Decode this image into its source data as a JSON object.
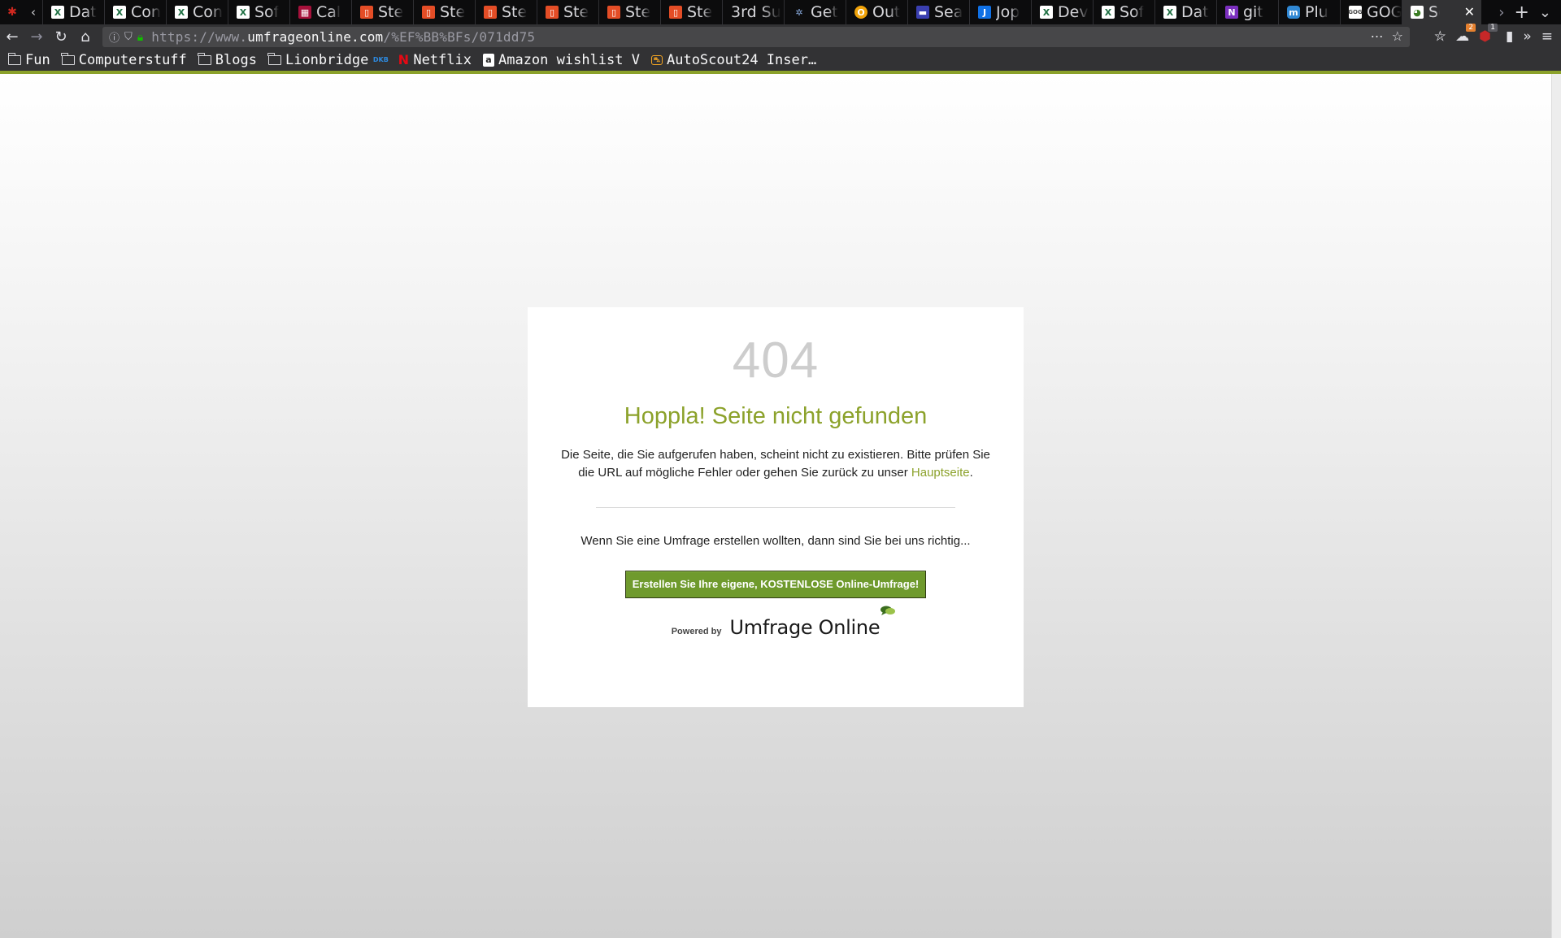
{
  "browser": {
    "tabs": [
      {
        "label": "Dat",
        "favicon": "x-icon"
      },
      {
        "label": "Con",
        "favicon": "x-icon"
      },
      {
        "label": "Con",
        "favicon": "x-icon"
      },
      {
        "label": "Sof",
        "favicon": "x-icon"
      },
      {
        "label": "Cal",
        "favicon": "cal-icon"
      },
      {
        "label": "Ste",
        "favicon": "doc-icon"
      },
      {
        "label": "Ste",
        "favicon": "doc-icon"
      },
      {
        "label": "Ste",
        "favicon": "doc-icon"
      },
      {
        "label": "Ste",
        "favicon": "doc-icon"
      },
      {
        "label": "Ste",
        "favicon": "doc-icon"
      },
      {
        "label": "Ste",
        "favicon": "doc-icon"
      },
      {
        "label": "3rd Su",
        "favicon": "none"
      },
      {
        "label": "Get",
        "favicon": "get-icon"
      },
      {
        "label": "Out",
        "favicon": "out-icon"
      },
      {
        "label": "Sea",
        "favicon": "sea-icon"
      },
      {
        "label": "Jop",
        "favicon": "j-icon"
      },
      {
        "label": "Dev",
        "favicon": "x-icon"
      },
      {
        "label": "Sof",
        "favicon": "x-icon"
      },
      {
        "label": "Dat",
        "favicon": "x-icon"
      },
      {
        "label": "git",
        "favicon": "n-icon"
      },
      {
        "label": "Plu",
        "favicon": "m-icon"
      },
      {
        "label": "GOG",
        "favicon": "gog-icon"
      },
      {
        "label": "Sc",
        "favicon": "umf-icon",
        "active": true
      }
    ],
    "url": {
      "prefix": "https://www.",
      "host": "umfrageonline.com",
      "path": "/%EF%BB%BFs/071dd75"
    },
    "badges": {
      "sync": "2",
      "ublock": "1"
    },
    "bookmarks": [
      {
        "label": "Fun",
        "icon": "folder-icon"
      },
      {
        "label": "Computerstuff",
        "icon": "folder-icon"
      },
      {
        "label": "Blogs",
        "icon": "folder-icon"
      },
      {
        "label": "Lionbridge",
        "icon": "folder-icon"
      },
      {
        "label": "",
        "icon": "dkb-icon",
        "text": "DKB"
      },
      {
        "label": "Netflix",
        "icon": "netflix-icon"
      },
      {
        "label": "Amazon wishlist V",
        "icon": "amazon-icon"
      },
      {
        "label": "AutoScout24 Inser…",
        "icon": "autoscout-icon"
      }
    ]
  },
  "page": {
    "error_code": "404",
    "title": "Hoppla! Seite nicht gefunden",
    "message_1": "Die Seite, die Sie aufgerufen haben, scheint nicht zu existieren. Bitte prüfen Sie die URL auf mögliche Fehler oder gehen Sie zurück zu unser ",
    "message_link": "Hauptseite",
    "message_end": ".",
    "cta_text": "Wenn Sie eine Umfrage erstellen wollten, dann sind Sie bei uns richtig...",
    "cta_button": "Erstellen Sie Ihre eigene, KOSTENLOSE Online-Umfrage!",
    "powered_by": "Powered by",
    "logo_text": "Umfrage Online"
  },
  "colors": {
    "accent": "#8ca22b",
    "button": "#6f9a2d",
    "error_code": "#cdcdcd"
  }
}
